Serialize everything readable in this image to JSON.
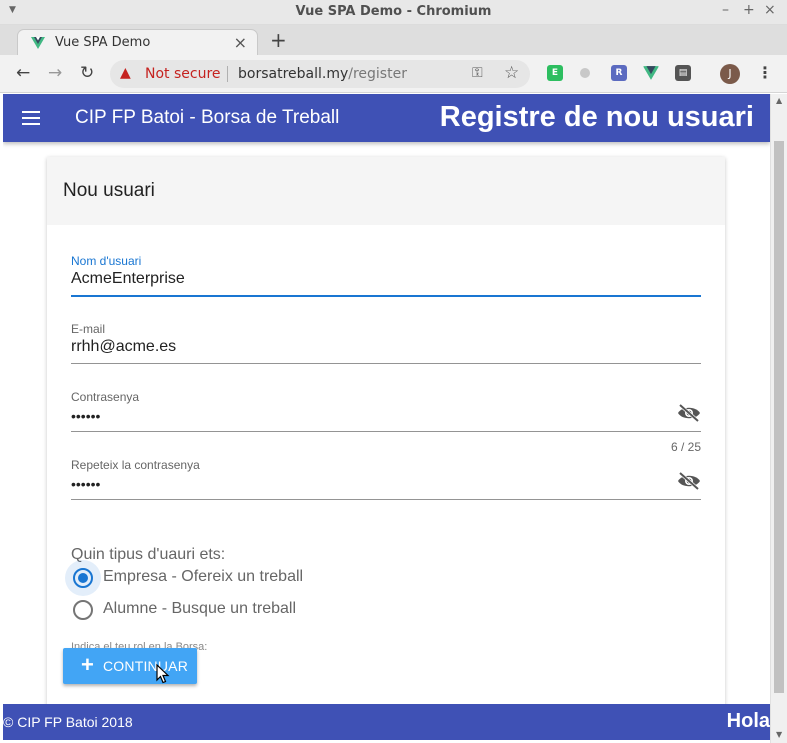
{
  "window": {
    "title": "Vue SPA Demo - Chromium",
    "controls": {
      "minimize": "–",
      "maximize": "+",
      "close": "×"
    }
  },
  "tab": {
    "title": "Vue SPA Demo",
    "close": "×",
    "new_tab": "+"
  },
  "toolbar": {
    "back": "←",
    "forward": "→",
    "reload": "↻",
    "security_label": "Not secure",
    "url_host": "borsatreball.my",
    "url_path": "/register",
    "avatar_initial": "J",
    "extensions": [
      "evernote-icon",
      "circle-extension-icon",
      "r-extension-icon",
      "vue-devtools-icon",
      "clipboard-extension-icon"
    ]
  },
  "app": {
    "title": "CIP FP Batoi - Borsa de Treball",
    "page_heading": "Registre de nou usuari",
    "accent_color": "#3f51b5",
    "primary_color": "#1976d2"
  },
  "form": {
    "card_title": "Nou usuari",
    "username": {
      "label": "Nom d'usuari",
      "value": "AcmeEnterprise"
    },
    "email": {
      "label": "E-mail",
      "value": "rrhh@acme.es"
    },
    "password": {
      "label": "Contrasenya",
      "value": "••••••",
      "counter": "6 / 25"
    },
    "password_repeat": {
      "label": "Repeteix la contrasenya",
      "value": "••••••"
    },
    "user_type_question": "Quin tipus d'uauri ets:",
    "user_type_options": [
      {
        "label": "Empresa - Ofereix un treball",
        "selected": true
      },
      {
        "label": "Alumne - Busque un treball",
        "selected": false
      }
    ],
    "hint": "Indica el teu rol en la Borsa:",
    "submit_label": "CONTINUAR"
  },
  "footer": {
    "copyright": "© CIP FP Batoi 2018",
    "greeting": "Hola"
  }
}
